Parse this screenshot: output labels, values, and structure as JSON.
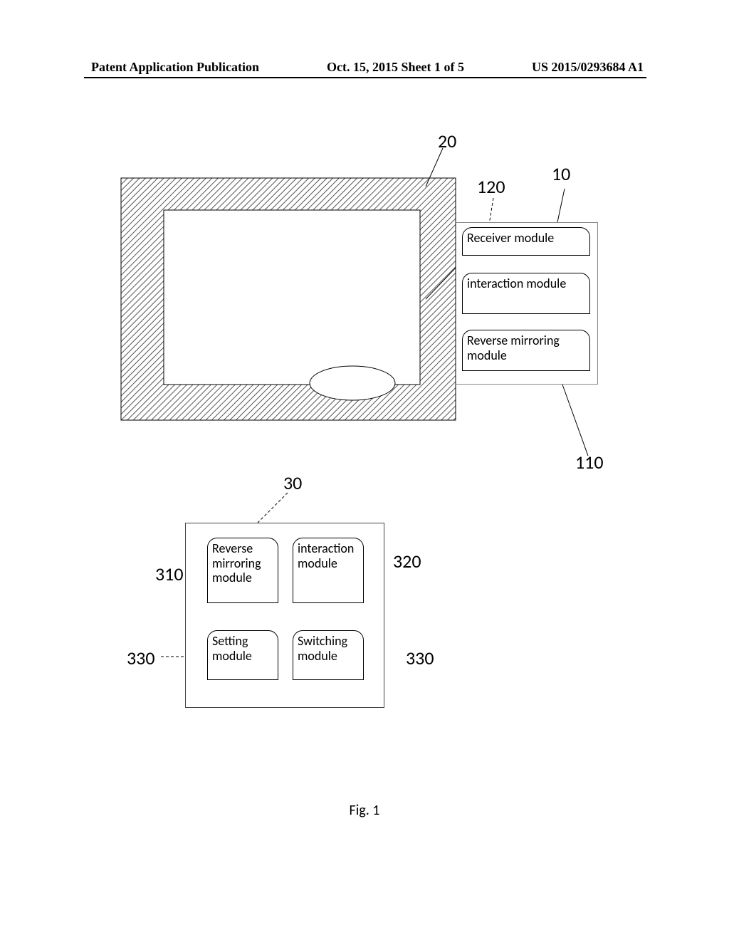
{
  "header": {
    "left": "Patent Application Publication",
    "center": "Oct. 15, 2015  Sheet 1 of 5",
    "right": "US 2015/0293684 A1"
  },
  "refs": {
    "r20": "20",
    "r10": "10",
    "r120": "120",
    "r110": "110",
    "r30": "30",
    "r310": "310",
    "r320": "320",
    "r330a": "330",
    "r330b": "330"
  },
  "modules": {
    "tv_receiver": "Receiver module",
    "tv_interaction": "interaction module",
    "tv_reverse": "Reverse mirroring module",
    "d_reverse": "Reverse mirroring module",
    "d_interaction": "interaction module",
    "d_setting": "Setting module",
    "d_switching": "Switching module"
  },
  "figure_label": "Fig. 1"
}
